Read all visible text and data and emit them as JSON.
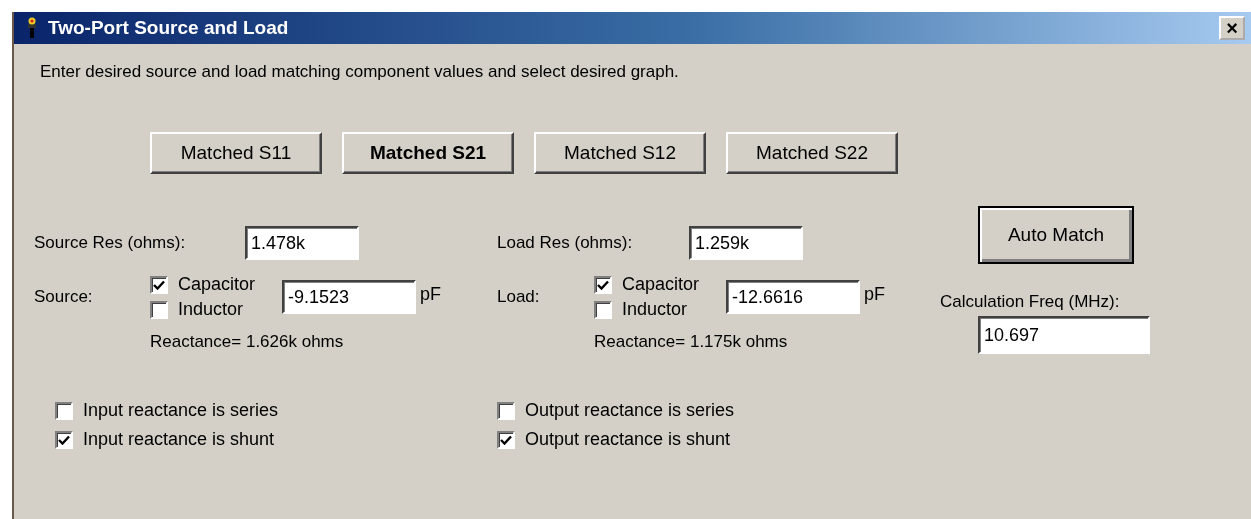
{
  "window": {
    "title": "Two-Port Source and Load",
    "close_label": "×"
  },
  "instruction": "Enter desired source and load matching component values and select desired graph.",
  "graph_buttons": [
    {
      "label": "Matched S11",
      "selected": false
    },
    {
      "label": "Matched S21",
      "selected": true
    },
    {
      "label": "Matched S12",
      "selected": false
    },
    {
      "label": "Matched S22",
      "selected": false
    }
  ],
  "source": {
    "res_label": "Source Res (ohms):",
    "res_value": "1.478k",
    "label": "Source:",
    "options": [
      {
        "label": "Capacitor",
        "checked": true
      },
      {
        "label": "Inductor",
        "checked": false
      }
    ],
    "value": "-9.1523",
    "unit": "pF",
    "reactance": "Reactance= 1.626k ohms",
    "topology": [
      {
        "label": "Input reactance is series",
        "checked": false
      },
      {
        "label": "Input reactance is shunt",
        "checked": true
      }
    ]
  },
  "load": {
    "res_label": "Load Res (ohms):",
    "res_value": "1.259k",
    "label": "Load:",
    "options": [
      {
        "label": "Capacitor",
        "checked": true
      },
      {
        "label": "Inductor",
        "checked": false
      }
    ],
    "value": "-12.6616",
    "unit": "pF",
    "reactance": "Reactance= 1.175k ohms",
    "topology": [
      {
        "label": "Output reactance is series",
        "checked": false
      },
      {
        "label": "Output reactance is shunt",
        "checked": true
      }
    ]
  },
  "auto_match": "Auto Match",
  "freq": {
    "label": "Calculation Freq (MHz):",
    "value": "10.697"
  }
}
